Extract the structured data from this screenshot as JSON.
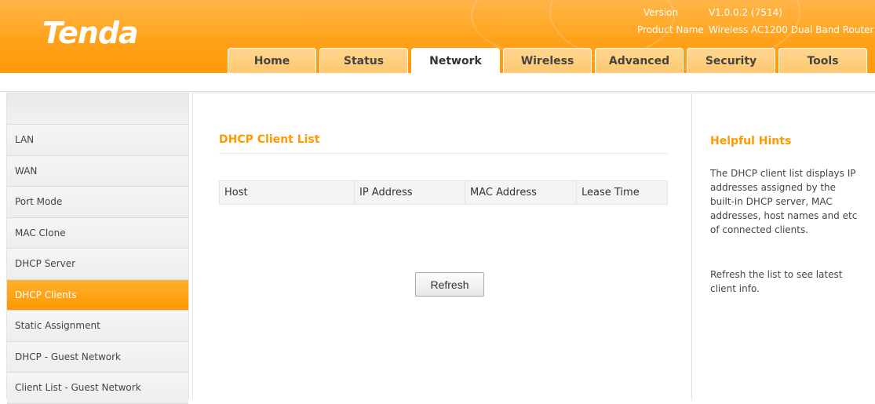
{
  "header": {
    "logo": "Tenda",
    "version_label": "Version",
    "version_value": "V1.0.0.2 (7514)",
    "product_label": "Product Name",
    "product_value": "Wireless AC1200 Dual Band Router"
  },
  "tabs": [
    "Home",
    "Status",
    "Network",
    "Wireless",
    "Advanced",
    "Security",
    "Tools"
  ],
  "active_tab": "Network",
  "sidebar": {
    "items": [
      "LAN",
      "WAN",
      "Port Mode",
      "MAC Clone",
      "DHCP Server",
      "DHCP Clients",
      "Static Assignment",
      "DHCP - Guest Network",
      "Client List - Guest Network"
    ],
    "active_item": "DHCP Clients"
  },
  "main": {
    "title": "DHCP Client List",
    "columns": [
      "Host",
      "IP Address",
      "MAC Address",
      "Lease Time"
    ],
    "refresh_label": "Refresh"
  },
  "hints": {
    "title": "Helpful Hints",
    "paragraph1": "The DHCP client list displays IP addresses assigned by the built-in DHCP server, MAC addresses, host names and etc of connected clients.",
    "paragraph2": "Refresh the list to see latest client info."
  },
  "colors": {
    "accent": "#ff9900",
    "header_orange": "#ffa21a",
    "active_sidebar": "#ff9800"
  }
}
